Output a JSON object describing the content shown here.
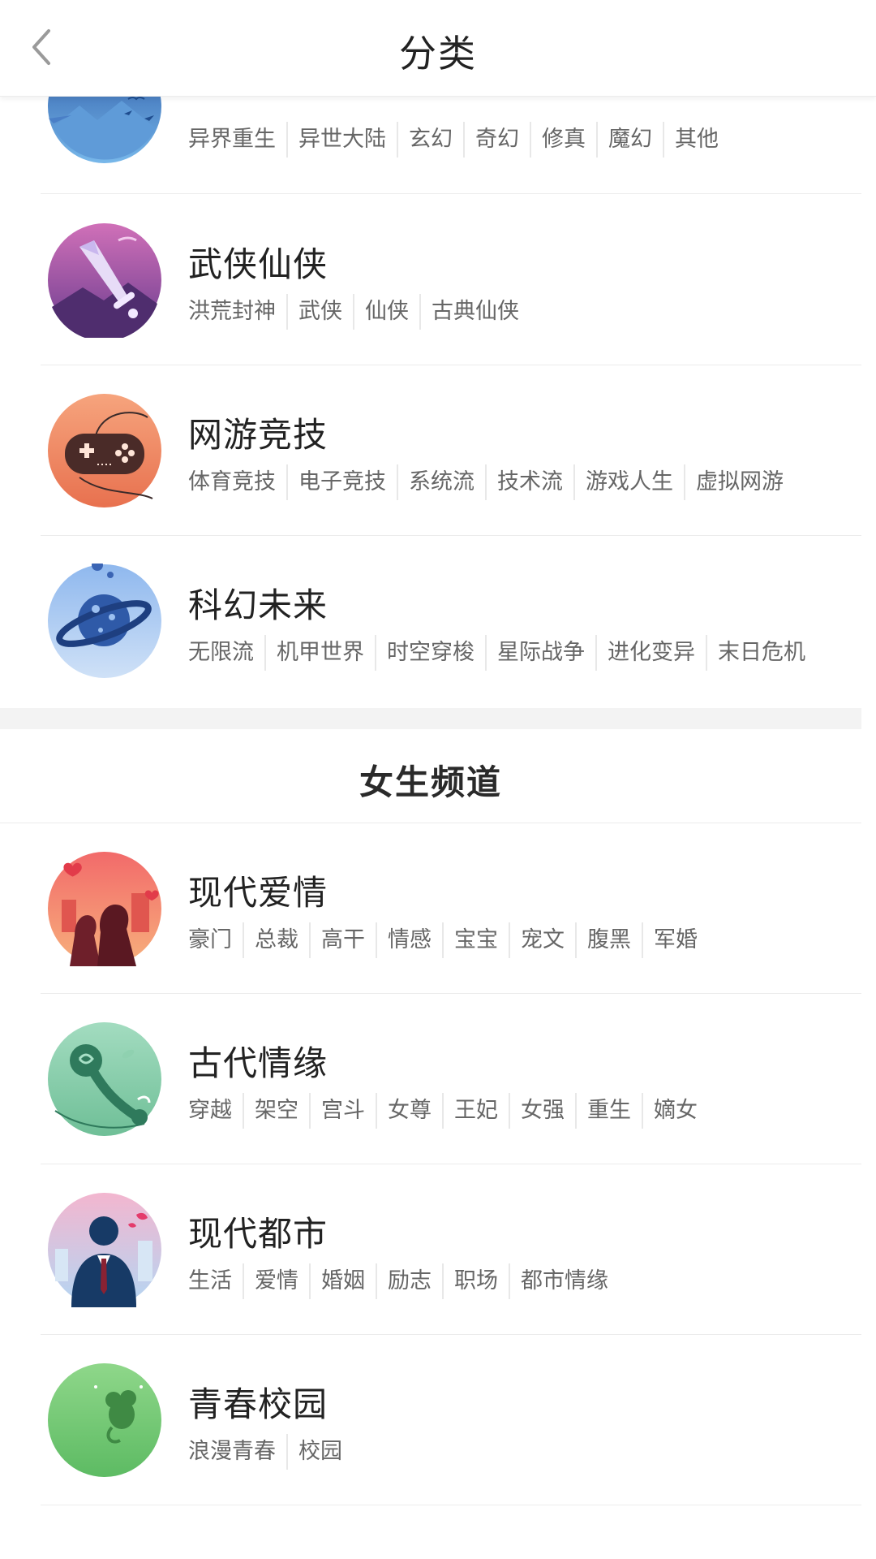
{
  "header": {
    "title": "分类",
    "back_icon": "chevron-left-icon"
  },
  "male_categories": [
    {
      "title": "",
      "icon": "mountain-birds-icon",
      "tags": [
        "异界重生",
        "异世大陆",
        "玄幻",
        "奇幻",
        "修真",
        "魔幻",
        "其他"
      ]
    },
    {
      "title": "武侠仙侠",
      "icon": "sword-icon",
      "tags": [
        "洪荒封神",
        "武侠",
        "仙侠",
        "古典仙侠"
      ]
    },
    {
      "title": "网游竞技",
      "icon": "gamepad-icon",
      "tags": [
        "体育竞技",
        "电子竞技",
        "系统流",
        "技术流",
        "游戏人生",
        "虚拟网游"
      ]
    },
    {
      "title": "科幻未来",
      "icon": "planet-icon",
      "tags": [
        "无限流",
        "机甲世界",
        "时空穿梭",
        "星际战争",
        "进化变异",
        "末日危机"
      ]
    }
  ],
  "female_section": {
    "title": "女生频道"
  },
  "female_categories": [
    {
      "title": "现代爱情",
      "icon": "couple-icon",
      "tags": [
        "豪门",
        "总裁",
        "高干",
        "情感",
        "宝宝",
        "宠文",
        "腹黑",
        "军婚"
      ]
    },
    {
      "title": "古代情缘",
      "icon": "jade-ruyi-icon",
      "tags": [
        "穿越",
        "架空",
        "宫斗",
        "女尊",
        "王妃",
        "女强",
        "重生",
        "嫡女"
      ]
    },
    {
      "title": "现代都市",
      "icon": "businessman-icon",
      "tags": [
        "生活",
        "爱情",
        "婚姻",
        "励志",
        "职场",
        "都市情缘"
      ]
    },
    {
      "title": "青春校园",
      "icon": "moon-mouse-icon",
      "tags": [
        "浪漫青春",
        "校园"
      ]
    }
  ],
  "colors": {
    "fantasy": "#3f78c2",
    "wuxia": "#8e4fb0",
    "game": "#ee7e5a",
    "scifi": "#6b9fe0",
    "romance": "#e8606a",
    "ancient": "#7ec9a3",
    "urban": "#a8c8ef",
    "campus": "#7fcf79"
  }
}
